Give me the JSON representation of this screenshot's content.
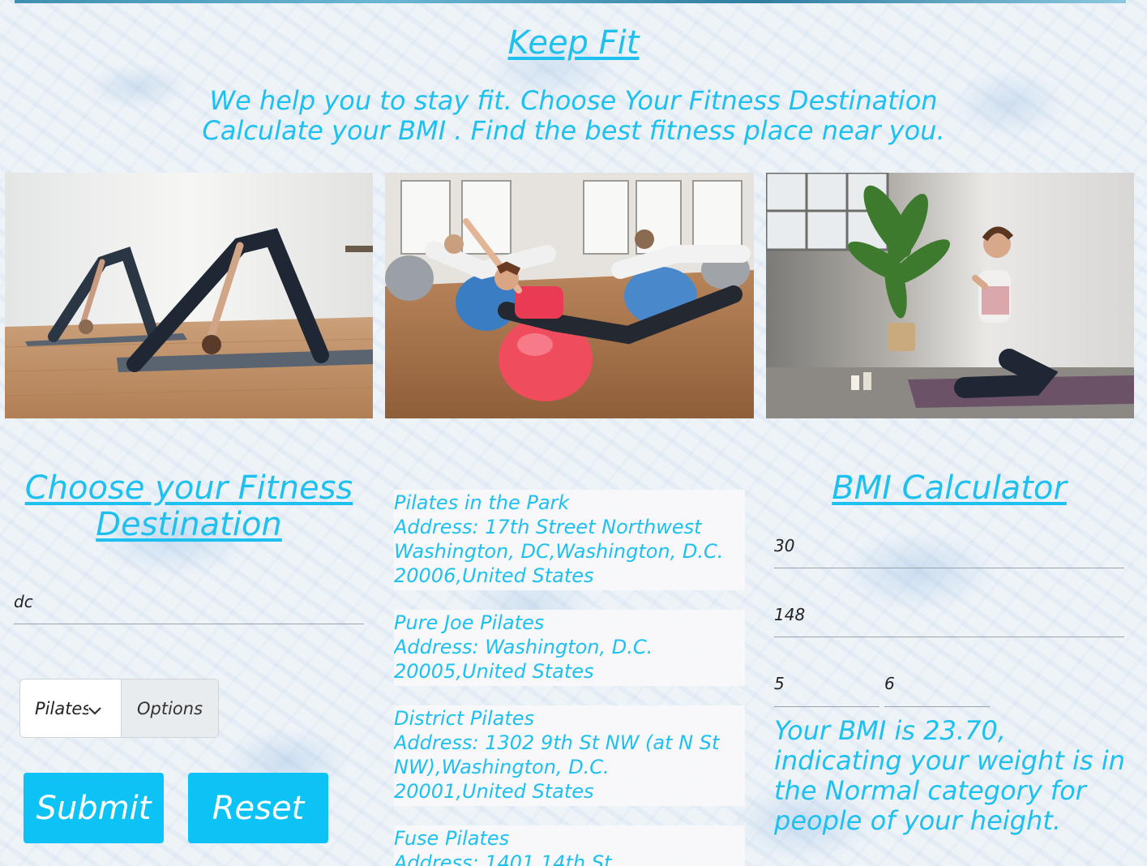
{
  "header": {
    "title": "Keep Fit",
    "tagline_line1": "We help you to stay fit. Choose Your Fitness Destination",
    "tagline_line2": "Calculate your BMI . Find the best fitness place near you."
  },
  "gallery": {
    "photos": [
      "yoga-downward-dog-photo",
      "pilates-ball-class-photo",
      "meditation-photo"
    ]
  },
  "destination": {
    "heading": "Choose your Fitness Destination",
    "location_value": "dc",
    "select_value": "Pilates",
    "select_label": "Options",
    "submit_label": "Submit",
    "reset_label": "Reset"
  },
  "results": [
    {
      "name": "Pilates in the Park",
      "address": "Address: 17th Street Northwest Washington, DC,Washington, D.C. 20006,United States"
    },
    {
      "name": "Pure Joe Pilates",
      "address": "Address: Washington, D.C. 20005,United States"
    },
    {
      "name": "District Pilates",
      "address": "Address: 1302 9th St NW (at N St NW),Washington, D.C. 20001,United States"
    },
    {
      "name": "Fuse Pilates",
      "address": "Address: 1401 14th St"
    }
  ],
  "bmi": {
    "heading": "BMI Calculator",
    "age_value": "30",
    "weight_value": "148",
    "feet_value": "5",
    "inches_value": "6",
    "result_text": "Your BMI is 23.70, indicating your weight is in the Normal category for people of your height."
  },
  "colors": {
    "accent": "#1ec0f0",
    "button": "#0dc2f5"
  }
}
